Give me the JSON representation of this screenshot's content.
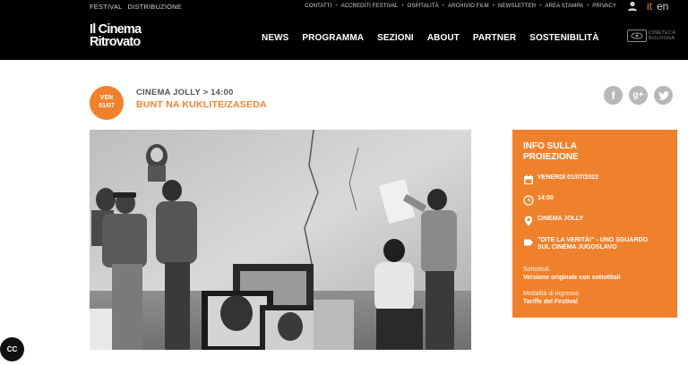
{
  "topbar": {
    "left": [
      "FESTIVAL",
      "DISTRIBUZIONE"
    ],
    "right": [
      "CONTATTI",
      "ACCREDITI FESTIVAL",
      "OSPITALITÀ",
      "ARCHIVIO FILM",
      "NEWSLETTER",
      "AREA STAMPA",
      "PRIVACY"
    ],
    "lang_it": "it",
    "lang_en": "en"
  },
  "header": {
    "logo_line1": "Il Cinema",
    "logo_line2": "Ritrovato",
    "nav": [
      "NEWS",
      "PROGRAMMA",
      "SEZIONI",
      "ABOUT",
      "PARTNER",
      "SOSTENIBILITÀ"
    ],
    "cineteca_line1": "CINETECA",
    "cineteca_line2": "BOLOGNA"
  },
  "event": {
    "day": "VEN",
    "date": "01/07",
    "venue_time": "CINEMA JOLLY > 14:00",
    "title": "BUNT NA KUKLITE/ZASEDA"
  },
  "social": [
    "f",
    "g+",
    "t"
  ],
  "info": {
    "heading_1": "INFO SULLA",
    "heading_2": "PROIEZIONE",
    "date": "VENERDÌ 01/07/2022",
    "time": "14:00",
    "place": "CINEMA JOLLY",
    "section_1": "\"DITE LA VERITÀ!\" - UNO SGUARDO",
    "section_2": "SUL CINEMA JUGOSLAVO",
    "subtitles_label": "Sottotitoli",
    "subtitles_value": "Versione originale con sottotitoli",
    "entry_label": "Modalità di ingresso",
    "entry_value": "Tariffe del Festival"
  },
  "colors": {
    "accent": "#f0812c",
    "black": "#000000",
    "gray_icon": "#b8b8b8"
  },
  "cc_label": "CC"
}
